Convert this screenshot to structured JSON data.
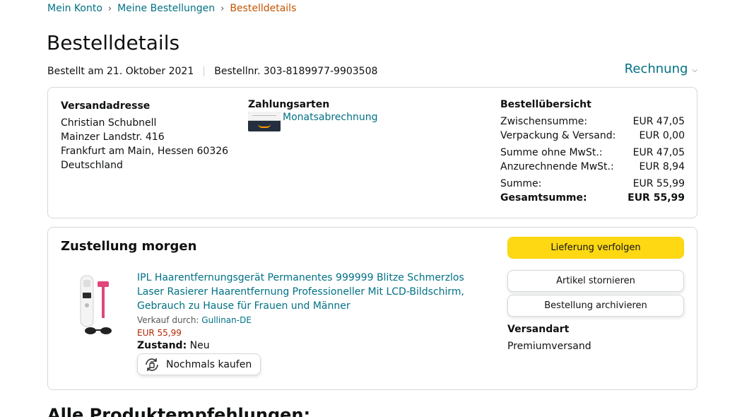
{
  "breadcrumb": {
    "items": [
      "Mein Konto",
      "Meine Bestellungen"
    ],
    "current": "Bestelldetails",
    "separator": "›"
  },
  "page_title": "Bestelldetails",
  "order_meta": {
    "date": "Bestellt am 21. Oktober 2021",
    "number": "Bestellnr. 303-8189977-9903508"
  },
  "invoice": {
    "label": "Rechnung",
    "icon": "chevron-down-icon"
  },
  "shipping_address": {
    "title": "Versandadresse",
    "lines": [
      "Christian Schubnell",
      "Mainzer Landstr. 416",
      "Frankfurt am Main, Hessen 60326",
      "Deutschland"
    ]
  },
  "payment": {
    "title": "Zahlungsarten",
    "method": "Monatsabrechnung",
    "icon": "amazon-card-icon"
  },
  "summary": {
    "title": "Bestellübersicht",
    "rows": [
      {
        "label": "Zwischensumme:",
        "value": "EUR 47,05"
      },
      {
        "label": "Verpackung & Versand:",
        "value": "EUR 0,00"
      },
      {
        "label": "Summe ohne MwSt.:",
        "value": "EUR 47,05"
      },
      {
        "label": "Anzurechnende MwSt.:",
        "value": "EUR 8,94"
      },
      {
        "label": "Summe:",
        "value": "EUR 55,99"
      },
      {
        "label": "Gesamtsumme:",
        "value": "EUR 55,99"
      }
    ]
  },
  "delivery": {
    "title": "Zustellung morgen",
    "product": {
      "title": "IPL Haarentfernungsgerät Permanentes 999999 Blitze Schmerzlos Laser Rasierer Haarentfernung Professioneller Mit LCD-Bildschirm, Gebrauch zu Hause für Frauen und Männer",
      "seller_label": "Verkauf durch:",
      "seller": "Gullinan-DE",
      "price": "EUR 55,99",
      "condition_label": "Zustand:",
      "condition": "Neu",
      "buy_again": "Nochmals kaufen"
    },
    "actions": {
      "track": "Lieferung verfolgen",
      "cancel": "Artikel stornieren",
      "archive": "Bestellung archivieren"
    },
    "shipping_type_title": "Versandart",
    "shipping_type": "Premiumversand"
  },
  "recommendations_title": "Alle Produktempfehlungen:",
  "colors": {
    "link": "#007185",
    "accent_button": "#ffd814",
    "price": "#b12704",
    "breadcrumb_current": "#c45500"
  }
}
